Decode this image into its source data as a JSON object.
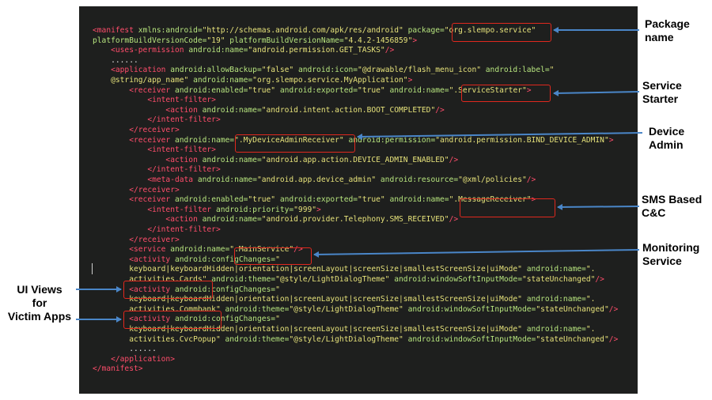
{
  "code_lines": [
    [
      {
        "c": "tg",
        "t": "<manifest "
      },
      {
        "c": "at",
        "t": "xmlns:android="
      },
      {
        "c": "st",
        "t": "\"http://schemas.android.com/apk/res/android\" "
      },
      {
        "c": "at",
        "t": "package="
      },
      {
        "c": "st",
        "t": "\"org.slempo.service\""
      }
    ],
    [
      {
        "c": "at",
        "t": "platformBuildVersionCode="
      },
      {
        "c": "st",
        "t": "\"19\" "
      },
      {
        "c": "at",
        "t": "platformBuildVersionName="
      },
      {
        "c": "st",
        "t": "\"4.4.2-1456859\""
      },
      {
        "c": "tg",
        "t": ">"
      }
    ],
    [
      {
        "c": "tx",
        "t": "    "
      },
      {
        "c": "tg",
        "t": "<uses-permission "
      },
      {
        "c": "at",
        "t": "android:name="
      },
      {
        "c": "st",
        "t": "\"android.permission.GET_TASKS\""
      },
      {
        "c": "tg",
        "t": "/>"
      }
    ],
    [
      {
        "c": "tx",
        "t": "    ......"
      }
    ],
    [
      {
        "c": "tx",
        "t": "    "
      },
      {
        "c": "tg",
        "t": "<application "
      },
      {
        "c": "at",
        "t": "android:allowBackup="
      },
      {
        "c": "st",
        "t": "\"false\" "
      },
      {
        "c": "at",
        "t": "android:icon="
      },
      {
        "c": "st",
        "t": "\"@drawable/flash_menu_icon\" "
      },
      {
        "c": "at",
        "t": "android:label="
      },
      {
        "c": "st",
        "t": "\""
      }
    ],
    [
      {
        "c": "st",
        "t": "    @string/app_name\" "
      },
      {
        "c": "at",
        "t": "android:name="
      },
      {
        "c": "st",
        "t": "\"org.slempo.service.MyApplication\""
      },
      {
        "c": "tg",
        "t": ">"
      }
    ],
    [
      {
        "c": "tx",
        "t": "        "
      },
      {
        "c": "tg",
        "t": "<receiver "
      },
      {
        "c": "at",
        "t": "android:enabled="
      },
      {
        "c": "st",
        "t": "\"true\" "
      },
      {
        "c": "at",
        "t": "android:exported="
      },
      {
        "c": "st",
        "t": "\"true\" "
      },
      {
        "c": "at",
        "t": "android:name="
      },
      {
        "c": "st",
        "t": "\".ServiceStarter\""
      },
      {
        "c": "tg",
        "t": ">"
      }
    ],
    [
      {
        "c": "tx",
        "t": "            "
      },
      {
        "c": "tg",
        "t": "<intent-filter>"
      }
    ],
    [
      {
        "c": "tx",
        "t": "                "
      },
      {
        "c": "tg",
        "t": "<action "
      },
      {
        "c": "at",
        "t": "android:name="
      },
      {
        "c": "st",
        "t": "\"android.intent.action.BOOT_COMPLETED\""
      },
      {
        "c": "tg",
        "t": "/>"
      }
    ],
    [
      {
        "c": "tx",
        "t": "            "
      },
      {
        "c": "tg",
        "t": "</intent-filter>"
      }
    ],
    [
      {
        "c": "tx",
        "t": "        "
      },
      {
        "c": "tg",
        "t": "</receiver>"
      }
    ],
    [
      {
        "c": "tx",
        "t": "        "
      },
      {
        "c": "tg",
        "t": "<receiver "
      },
      {
        "c": "at",
        "t": "android:name="
      },
      {
        "c": "st",
        "t": "\".MyDeviceAdminReceiver\" "
      },
      {
        "c": "at",
        "t": "android:permission="
      },
      {
        "c": "st",
        "t": "\"android.permission.BIND_DEVICE_ADMIN\""
      },
      {
        "c": "tg",
        "t": ">"
      }
    ],
    [
      {
        "c": "tx",
        "t": "            "
      },
      {
        "c": "tg",
        "t": "<intent-filter>"
      }
    ],
    [
      {
        "c": "tx",
        "t": "                "
      },
      {
        "c": "tg",
        "t": "<action "
      },
      {
        "c": "at",
        "t": "android:name="
      },
      {
        "c": "st",
        "t": "\"android.app.action.DEVICE_ADMIN_ENABLED\""
      },
      {
        "c": "tg",
        "t": "/>"
      }
    ],
    [
      {
        "c": "tx",
        "t": "            "
      },
      {
        "c": "tg",
        "t": "</intent-filter>"
      }
    ],
    [
      {
        "c": "tx",
        "t": "            "
      },
      {
        "c": "tg",
        "t": "<meta-data "
      },
      {
        "c": "at",
        "t": "android:name="
      },
      {
        "c": "st",
        "t": "\"android.app.device_admin\" "
      },
      {
        "c": "at",
        "t": "android:resource="
      },
      {
        "c": "st",
        "t": "\"@xml/policies\""
      },
      {
        "c": "tg",
        "t": "/>"
      }
    ],
    [
      {
        "c": "tx",
        "t": "        "
      },
      {
        "c": "tg",
        "t": "</receiver>"
      }
    ],
    [
      {
        "c": "tx",
        "t": "        "
      },
      {
        "c": "tg",
        "t": "<receiver "
      },
      {
        "c": "at",
        "t": "android:enabled="
      },
      {
        "c": "st",
        "t": "\"true\" "
      },
      {
        "c": "at",
        "t": "android:exported="
      },
      {
        "c": "st",
        "t": "\"true\" "
      },
      {
        "c": "at",
        "t": "android:name="
      },
      {
        "c": "st",
        "t": "\".MessageReceiver\""
      },
      {
        "c": "tg",
        "t": ">"
      }
    ],
    [
      {
        "c": "tx",
        "t": "            "
      },
      {
        "c": "tg",
        "t": "<intent-filter "
      },
      {
        "c": "at",
        "t": "android:priority="
      },
      {
        "c": "st",
        "t": "\"999\""
      },
      {
        "c": "tg",
        "t": ">"
      }
    ],
    [
      {
        "c": "tx",
        "t": "                "
      },
      {
        "c": "tg",
        "t": "<action "
      },
      {
        "c": "at",
        "t": "android:name="
      },
      {
        "c": "st",
        "t": "\"android.provider.Telephony.SMS_RECEIVED\""
      },
      {
        "c": "tg",
        "t": "/>"
      }
    ],
    [
      {
        "c": "tx",
        "t": "            "
      },
      {
        "c": "tg",
        "t": "</intent-filter>"
      }
    ],
    [
      {
        "c": "tx",
        "t": "        "
      },
      {
        "c": "tg",
        "t": "</receiver>"
      }
    ],
    [
      {
        "c": "tx",
        "t": "        "
      },
      {
        "c": "tg",
        "t": "<service "
      },
      {
        "c": "at",
        "t": "android:name="
      },
      {
        "c": "st",
        "t": "\".MainService\""
      },
      {
        "c": "tg",
        "t": "/>"
      }
    ],
    [
      {
        "c": "tx",
        "t": "        "
      },
      {
        "c": "tg",
        "t": "<activity "
      },
      {
        "c": "at",
        "t": "android:configChanges="
      },
      {
        "c": "st",
        "t": "\""
      }
    ],
    [
      {
        "c": "st",
        "t": "        keyboard|keyboardHidden|orientation|screenLayout|screenSize|smallestScreenSize|uiMode\" "
      },
      {
        "c": "at",
        "t": "android:name="
      },
      {
        "c": "st",
        "t": "\"."
      }
    ],
    [
      {
        "c": "st",
        "t": "        activities.Cards\" "
      },
      {
        "c": "at",
        "t": "android:theme="
      },
      {
        "c": "st",
        "t": "\"@style/LightDialogTheme\" "
      },
      {
        "c": "at",
        "t": "android:windowSoftInputMode="
      },
      {
        "c": "st",
        "t": "\"stateUnchanged\""
      },
      {
        "c": "tg",
        "t": "/>"
      }
    ],
    [
      {
        "c": "tx",
        "t": "        "
      },
      {
        "c": "tg",
        "t": "<activity "
      },
      {
        "c": "at",
        "t": "android:configChanges="
      },
      {
        "c": "st",
        "t": "\""
      }
    ],
    [
      {
        "c": "st",
        "t": "        keyboard|keyboardHidden|orientation|screenLayout|screenSize|smallestScreenSize|uiMode\" "
      },
      {
        "c": "at",
        "t": "android:name="
      },
      {
        "c": "st",
        "t": "\"."
      }
    ],
    [
      {
        "c": "st",
        "t": "        activities.Commbank\" "
      },
      {
        "c": "at",
        "t": "android:theme="
      },
      {
        "c": "st",
        "t": "\"@style/LightDialogTheme\" "
      },
      {
        "c": "at",
        "t": "android:windowSoftInputMode="
      },
      {
        "c": "st",
        "t": "\"stateUnchanged\""
      },
      {
        "c": "tg",
        "t": "/>"
      }
    ],
    [
      {
        "c": "tx",
        "t": "        "
      },
      {
        "c": "tg",
        "t": "<activity "
      },
      {
        "c": "at",
        "t": "android:configChanges="
      },
      {
        "c": "st",
        "t": "\""
      }
    ],
    [
      {
        "c": "st",
        "t": "        keyboard|keyboardHidden|orientation|screenLayout|screenSize|smallestScreenSize|uiMode\" "
      },
      {
        "c": "at",
        "t": "android:name="
      },
      {
        "c": "st",
        "t": "\"."
      }
    ],
    [
      {
        "c": "st",
        "t": "        activities.CvcPopup\" "
      },
      {
        "c": "at",
        "t": "android:theme="
      },
      {
        "c": "st",
        "t": "\"@style/LightDialogTheme\" "
      },
      {
        "c": "at",
        "t": "android:windowSoftInputMode="
      },
      {
        "c": "st",
        "t": "\"stateUnchanged\""
      },
      {
        "c": "tg",
        "t": "/>"
      }
    ],
    [
      {
        "c": "tx",
        "t": "        ......"
      }
    ],
    [
      {
        "c": "tx",
        "t": "    "
      },
      {
        "c": "tg",
        "t": "</application>"
      }
    ],
    [
      {
        "c": "tg",
        "t": "</manifest>"
      }
    ]
  ],
  "annotations": {
    "package_name": [
      "Package",
      "name"
    ],
    "service_starter": [
      "Service",
      "Starter"
    ],
    "device_admin": [
      "Device",
      "Admin"
    ],
    "sms_cc": [
      "SMS Based",
      "C&C"
    ],
    "monitoring_service": [
      "Monitoring",
      "Service"
    ],
    "ui_views": [
      "UI Views",
      "for",
      "Victim Apps"
    ]
  },
  "colors": {
    "background": "#1e1f1e",
    "tag": "#ff4d6b",
    "attribute": "#b7e57e",
    "string": "#e6e27a",
    "highlight_box": "#e0281e",
    "arrow": "#4a86c8"
  }
}
